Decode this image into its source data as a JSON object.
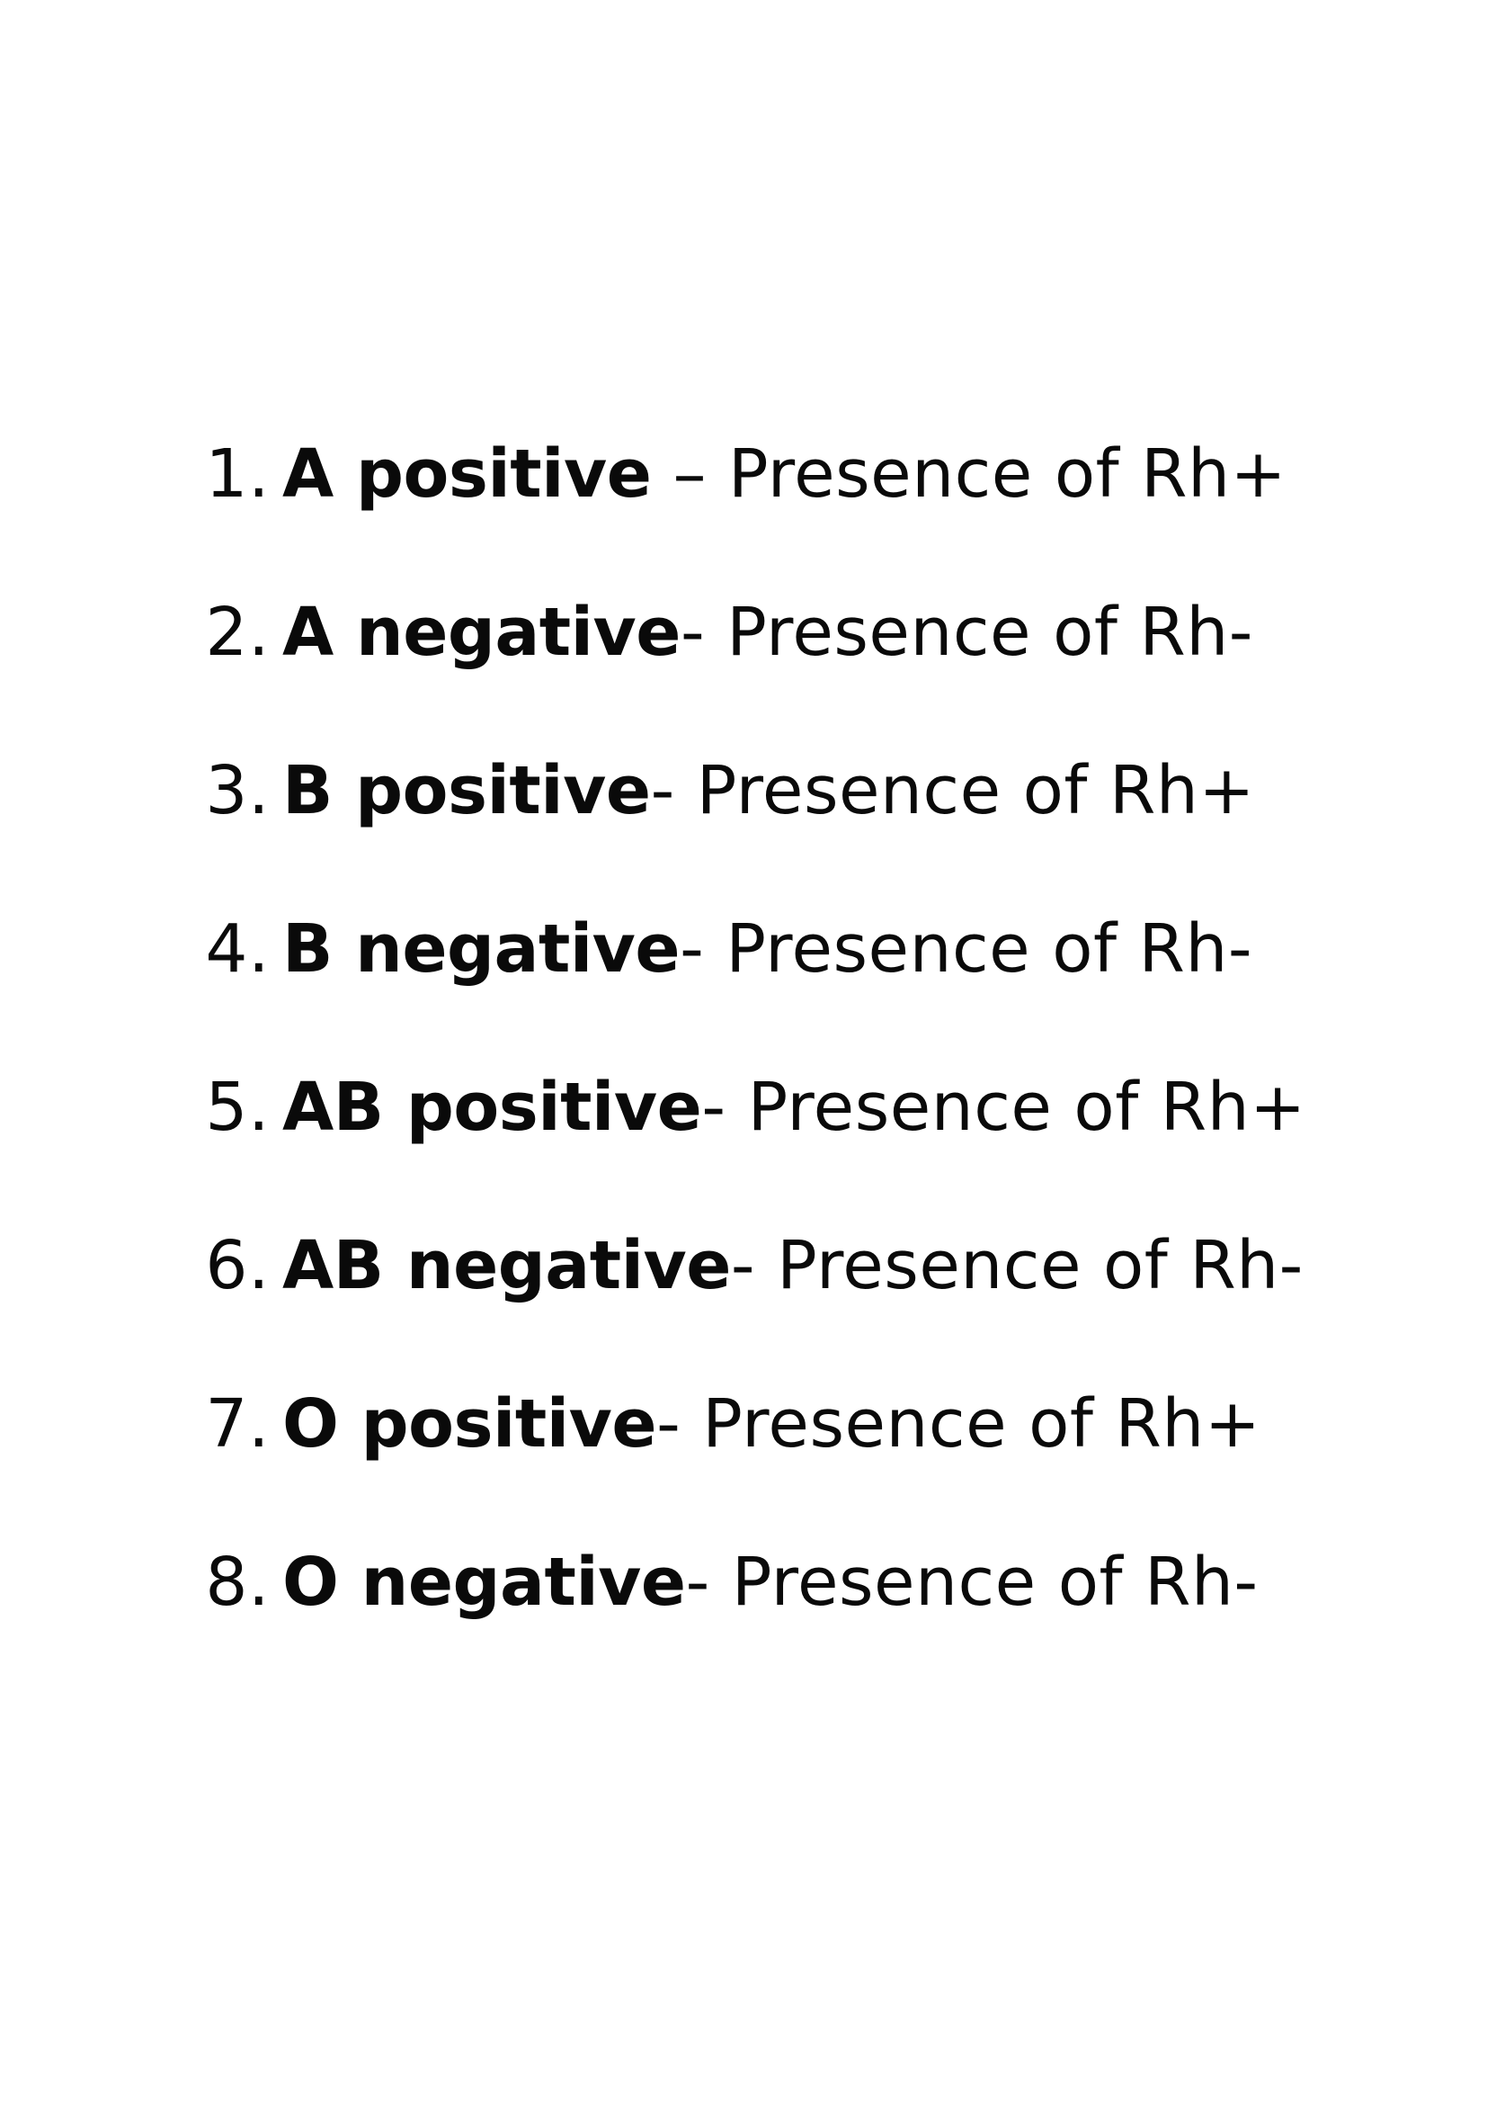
{
  "blood_groups": [
    {
      "number": "1.",
      "type": "A positive",
      "separator": " – ",
      "description": "Presence of Rh+"
    },
    {
      "number": "2.",
      "type": "A negative",
      "separator": "- ",
      "description": "Presence of Rh-"
    },
    {
      "number": "3.",
      "type": "B positive",
      "separator": "- ",
      "description": "Presence of Rh+"
    },
    {
      "number": "4.",
      "type": "B negative",
      "separator": "- ",
      "description": "Presence of Rh-"
    },
    {
      "number": "5.",
      "type": "AB positive",
      "separator": "- ",
      "description": "Presence of Rh+"
    },
    {
      "number": "6.",
      "type": "AB negative",
      "separator": "- ",
      "description": "Presence of Rh-"
    },
    {
      "number": "7.",
      "type": "O positive",
      "separator": "- ",
      "description": "Presence of Rh+"
    },
    {
      "number": "8.",
      "type": "O negative",
      "separator": "- ",
      "description": "Presence of Rh-"
    }
  ],
  "colors": {
    "text": "#0a0a0a",
    "background": "#ffffff"
  }
}
